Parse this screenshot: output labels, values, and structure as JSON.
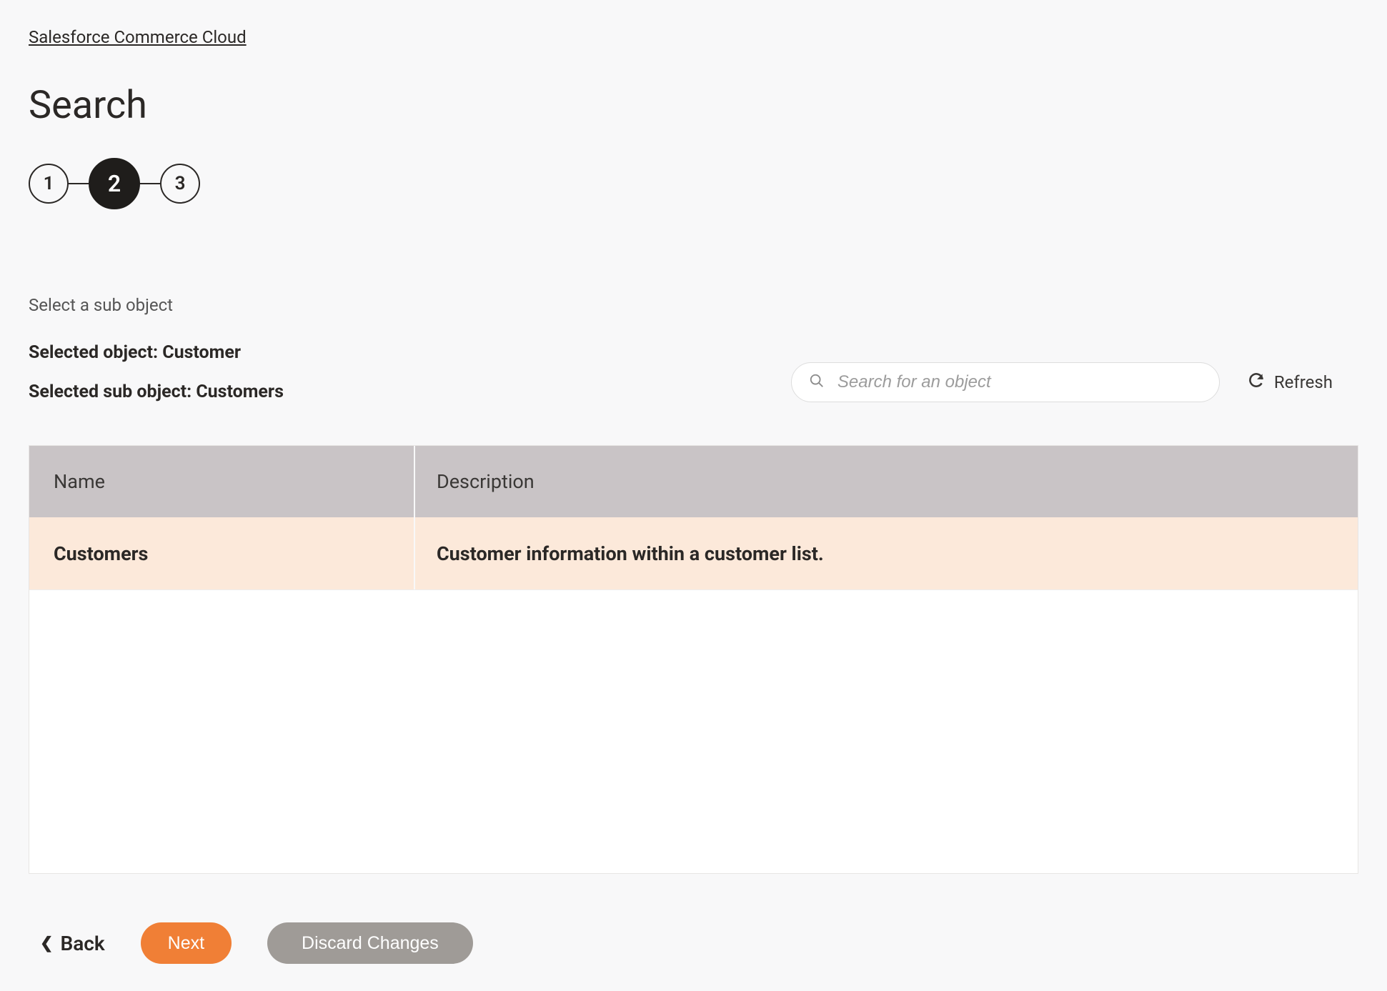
{
  "breadcrumb": "Salesforce Commerce Cloud",
  "title": "Search",
  "stepper": {
    "steps": [
      "1",
      "2",
      "3"
    ],
    "active_index": 1
  },
  "section": {
    "sub_label": "Select a sub object",
    "selected_object_prefix": "Selected object: ",
    "selected_object": "Customer",
    "selected_sub_object_prefix": "Selected sub object: ",
    "selected_sub_object": "Customers"
  },
  "search": {
    "placeholder": "Search for an object",
    "value": ""
  },
  "refresh_label": "Refresh",
  "table": {
    "columns": {
      "name": "Name",
      "description": "Description"
    },
    "rows": [
      {
        "name": "Customers",
        "description": "Customer information within a customer list."
      }
    ]
  },
  "footer": {
    "back": "Back",
    "next": "Next",
    "discard": "Discard Changes"
  }
}
